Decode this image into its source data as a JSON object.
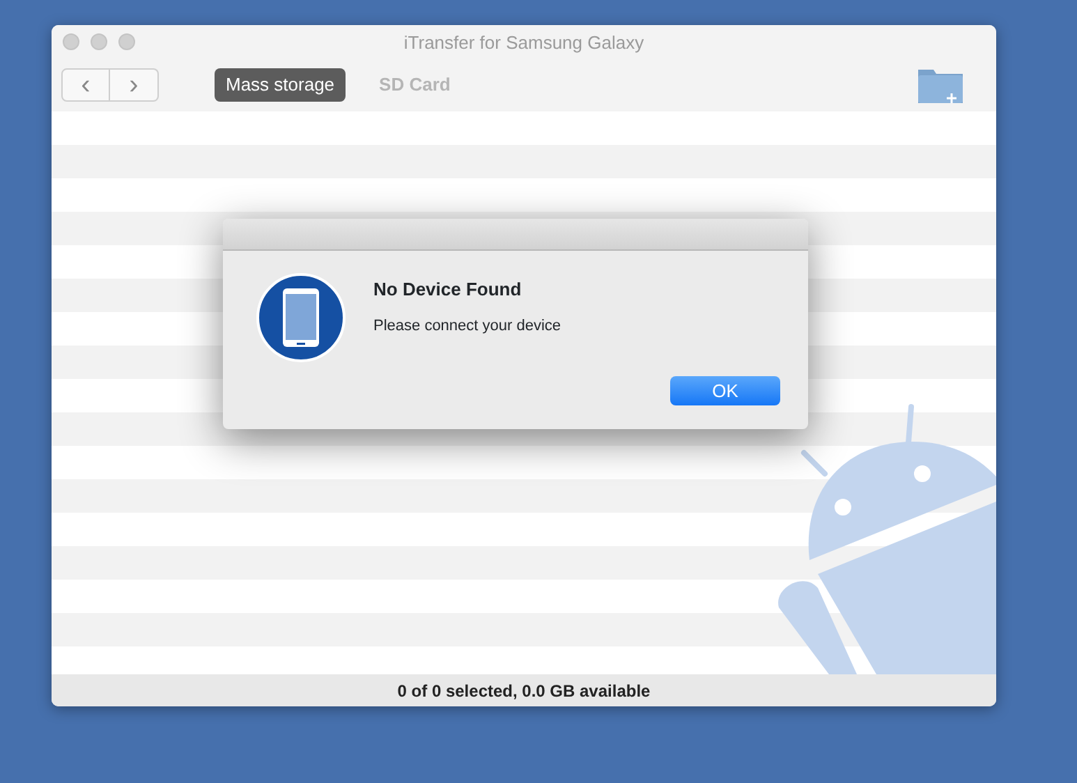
{
  "window": {
    "title": "iTransfer for Samsung Galaxy"
  },
  "toolbar": {
    "nav_buttons": [
      "‹",
      "›"
    ],
    "tabs": [
      {
        "label": "Mass storage",
        "selected": true
      },
      {
        "label": "SD Card",
        "selected": false
      }
    ]
  },
  "dialog": {
    "title": "No Device Found",
    "message": "Please connect your device",
    "button": "OK"
  },
  "status_bar": "0 of 0 selected, 0.0 GB available"
}
